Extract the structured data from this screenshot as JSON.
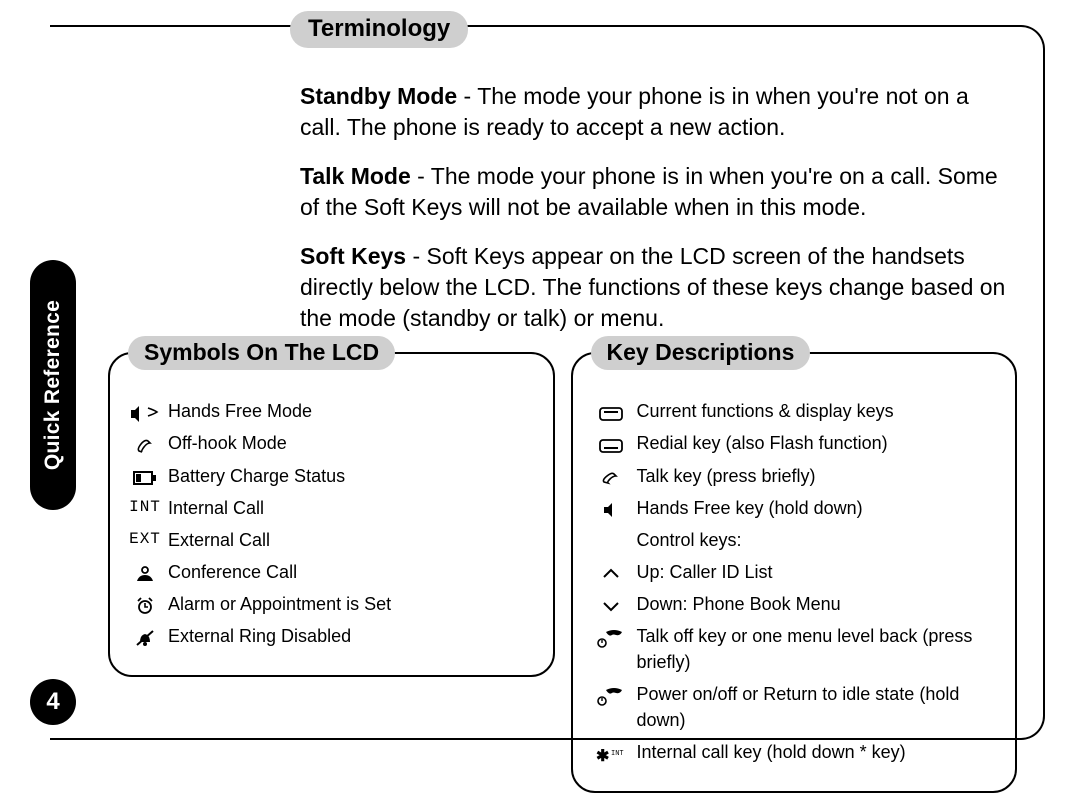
{
  "sidebar": {
    "tab_label": "Quick Reference"
  },
  "page_number": "4",
  "terminology": {
    "heading": "Terminology",
    "items": [
      {
        "term": "Standby Mode",
        "desc": " - The mode your phone is in when you're not on a call. The phone is ready to accept a new action."
      },
      {
        "term": "Talk Mode",
        "desc": " - The mode your phone is in when you're on a call. Some of the Soft Keys will not be available when in this mode."
      },
      {
        "term": "Soft Keys",
        "desc": " - Soft Keys appear on the LCD screen of the handsets directly below the LCD. The functions of these keys change based on the mode (standby or talk) or menu."
      }
    ]
  },
  "symbols": {
    "heading": "Symbols On The LCD",
    "items": [
      {
        "icon": "speaker-handset",
        "label": "Hands Free Mode"
      },
      {
        "icon": "offhook",
        "label": "Off-hook Mode"
      },
      {
        "icon": "battery",
        "label": "Battery Charge Status"
      },
      {
        "icon": "int-text",
        "label": "Internal Call"
      },
      {
        "icon": "ext-text",
        "label": "External Call"
      },
      {
        "icon": "conference",
        "label": "Conference Call"
      },
      {
        "icon": "alarm",
        "label": "Alarm or Appointment is Set"
      },
      {
        "icon": "bell-off",
        "label": "External Ring Disabled"
      }
    ]
  },
  "keys": {
    "heading": "Key Descriptions",
    "items": [
      {
        "icon": "softkey-top",
        "label": "Current functions & display keys"
      },
      {
        "icon": "softkey-bot",
        "label": "Redial key (also Flash function)"
      },
      {
        "icon": "talk-key",
        "label": "Talk key (press briefly)"
      },
      {
        "icon": "handsfree-key",
        "label": "Hands Free key (hold down)"
      },
      {
        "icon": "ctrl-header",
        "label": "Control keys:"
      },
      {
        "icon": "up-key",
        "label": "Up: Caller ID List"
      },
      {
        "icon": "down-key",
        "label": "Down: Phone Book Menu"
      },
      {
        "icon": "end-brief",
        "label": "Talk off key or one menu level back (press briefly)"
      },
      {
        "icon": "end-hold",
        "label": "Power on/off or Return to idle state (hold down)"
      },
      {
        "icon": "star-int",
        "label": "Internal call key (hold down * key)"
      }
    ]
  }
}
